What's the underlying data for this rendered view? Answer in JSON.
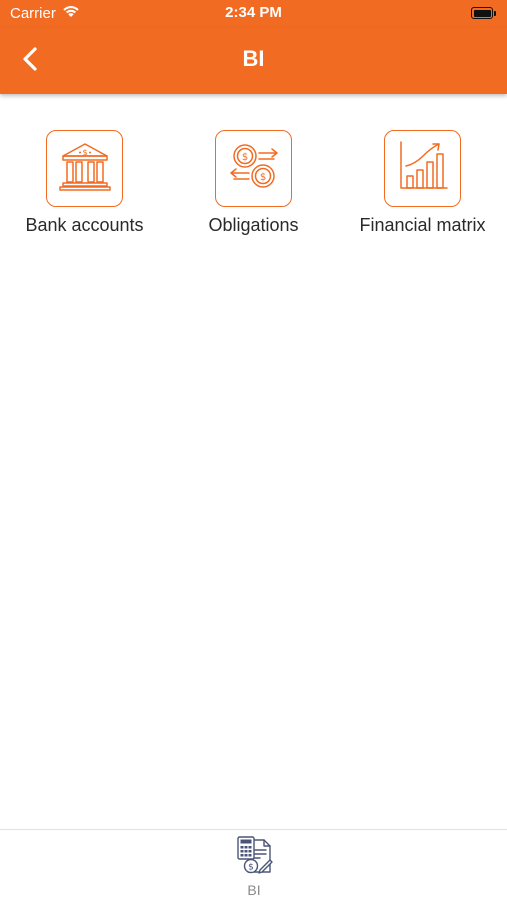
{
  "status_bar": {
    "carrier": "Carrier",
    "time": "2:34 PM"
  },
  "nav": {
    "title": "BI",
    "back_icon": "chevron-left-icon"
  },
  "tiles": [
    {
      "label": "Bank accounts",
      "icon": "bank-icon"
    },
    {
      "label": "Obligations",
      "icon": "obligations-icon"
    },
    {
      "label": "Financial matrix",
      "icon": "growth-chart-icon"
    }
  ],
  "tab_bar": {
    "items": [
      {
        "label": "BI",
        "icon": "bi-report-icon"
      }
    ]
  },
  "colors": {
    "accent": "#F26B22",
    "tab_icon": "#4a5578"
  }
}
